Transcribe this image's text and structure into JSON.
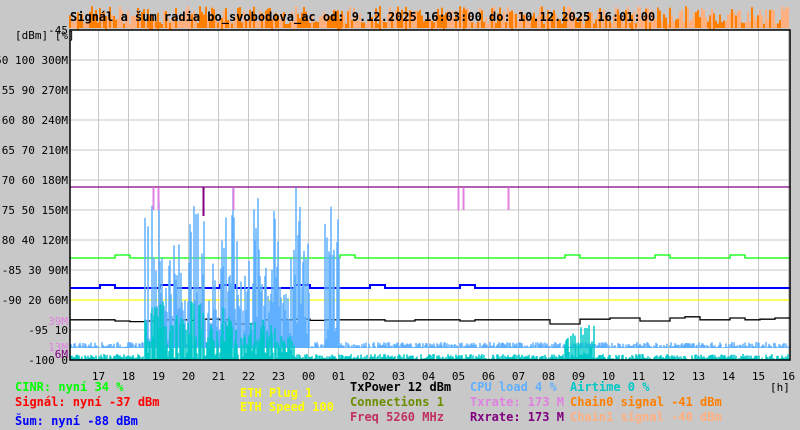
{
  "title": "Signál a šum radia bo_svobodova_ac od: 9.12.2025 16:03:00 do: 10.12.2025 16:01:00",
  "chart_data": {
    "type": "line",
    "title": "Signál a šum radia bo_svobodova_ac od: 9.12.2025 16:03:00 do: 10.12.2025 16:01:00",
    "y_unit_label": "[dBm] [%]",
    "xlabel": "[h]",
    "x_ticks": [
      "17",
      "18",
      "19",
      "20",
      "21",
      "22",
      "23",
      "00",
      "01",
      "02",
      "03",
      "04",
      "05",
      "06",
      "07",
      "08",
      "09",
      "10",
      "11",
      "12",
      "13",
      "14",
      "15",
      "16"
    ],
    "x_range": [
      "16:03",
      "16:01"
    ],
    "ylim": [
      -100,
      -45
    ],
    "y_ticks": [
      {
        "dbm": "-45",
        "pct": "",
        "rate": ""
      },
      {
        "dbm": "-50",
        "pct": "100",
        "rate": "300M"
      },
      {
        "dbm": "-55",
        "pct": "90",
        "rate": "270M"
      },
      {
        "dbm": "-60",
        "pct": "80",
        "rate": "240M"
      },
      {
        "dbm": "-65",
        "pct": "70",
        "rate": "210M"
      },
      {
        "dbm": "-70",
        "pct": "60",
        "rate": "180M"
      },
      {
        "dbm": "-75",
        "pct": "50",
        "rate": "150M"
      },
      {
        "dbm": "-80",
        "pct": "40",
        "rate": "120M"
      },
      {
        "dbm": "-85",
        "pct": "30",
        "rate": "90M"
      },
      {
        "dbm": "-90",
        "pct": "20",
        "rate": "60M"
      },
      {
        "dbm": "-95",
        "pct": "10",
        "rate": ""
      },
      {
        "dbm": "-100",
        "pct": "0",
        "rate": ""
      }
    ],
    "extra_labels": [
      {
        "text": "39M",
        "dbm": -93.5,
        "color": "#e080e0"
      },
      {
        "text": "13M",
        "dbm": -97.8,
        "color": "#e080e0"
      },
      {
        "text": "6M",
        "dbm": -99,
        "color": "#800080"
      }
    ],
    "grid": true,
    "bin_minutes": 30,
    "series": [
      {
        "name": "CINR",
        "unit": "%",
        "color": "#00ff00",
        "values": [
          34,
          34,
          34,
          35,
          34,
          34,
          34,
          34,
          34,
          34,
          34,
          34,
          34,
          34,
          34,
          34,
          34,
          34,
          35,
          34,
          34,
          34,
          34,
          34,
          34,
          34,
          34,
          34,
          34,
          34,
          34,
          34,
          34,
          35,
          34,
          34,
          34,
          34,
          34,
          35,
          34,
          34,
          34,
          34,
          35,
          34,
          34,
          34
        ]
      },
      {
        "name": "Šum",
        "unit": "dBm",
        "color": "#0000ff",
        "values": [
          -88,
          -88,
          -87.5,
          -88,
          -88,
          -88,
          -87.5,
          -88,
          -88,
          -88,
          -87.5,
          -88,
          -88,
          -88,
          -88,
          -87.5,
          -88,
          -88,
          -88,
          -88,
          -87.5,
          -88,
          -88,
          -88,
          -88,
          -88,
          -87.5,
          -88,
          -88,
          -88,
          -88,
          -88,
          -88,
          -88,
          -88,
          -88,
          -88,
          -88,
          -88,
          -88,
          -88,
          -88,
          -88,
          -88,
          -88,
          -88,
          -88,
          -88
        ]
      },
      {
        "name": "ETH",
        "unit": "dBm",
        "color": "#ffff00",
        "values": [
          -90,
          -90,
          -90,
          -90,
          -90,
          -90,
          -90,
          -90,
          -90,
          -90,
          -90,
          -90,
          -90,
          -90,
          -90,
          -90,
          -90,
          -90,
          -90,
          -90,
          -90,
          -90,
          -90,
          -90,
          -90,
          -90,
          -90,
          -90,
          -90,
          -90,
          -90,
          -90,
          -90,
          -90,
          -90,
          -90,
          -90,
          -90,
          -90,
          -90,
          -90,
          -90,
          -90,
          -90,
          -90,
          -90,
          -90,
          -90
        ]
      },
      {
        "name": "Rxrate",
        "unit": "M",
        "color": "#800080",
        "values": [
          173,
          173,
          173,
          173,
          173,
          173,
          173,
          173,
          173,
          173,
          173,
          173,
          173,
          173,
          173,
          173,
          173,
          173,
          173,
          173,
          173,
          173,
          173,
          173,
          173,
          173,
          173,
          173,
          173,
          173,
          173,
          173,
          173,
          173,
          173,
          173,
          173,
          173,
          173,
          173,
          173,
          173,
          173,
          173,
          173,
          173,
          173,
          173
        ]
      },
      {
        "name": "TxPower",
        "unit": "dBm",
        "color": "#000000",
        "values": [
          -93.3,
          -93.3,
          -93.3,
          -93.5,
          -93.6,
          -93.5,
          -93.3,
          -93.3,
          -93.4,
          -93.2,
          -93.3,
          -94,
          -94,
          -93.3,
          -93.3,
          -93.2,
          -93.4,
          -93.3,
          -93.3,
          -93.3,
          -93.3,
          -93.5,
          -93.5,
          -93.3,
          -93.3,
          -93.3,
          -93.5,
          -93.3,
          -93.3,
          -93.3,
          -93.3,
          -93.3,
          -94,
          -94,
          -93.2,
          -93.2,
          -93,
          -93,
          -93.5,
          -93.5,
          -93,
          -92.8,
          -93.3,
          -93.3,
          -93,
          -93.3,
          -93.2,
          -93
        ]
      },
      {
        "name": "CPU load",
        "unit": "%",
        "color": "#60b0ff",
        "values": [
          4,
          4,
          4,
          4,
          5,
          56,
          45,
          40,
          52,
          35,
          58,
          40,
          55,
          50,
          38,
          58,
          4,
          55,
          4,
          4,
          4,
          4,
          4,
          4,
          4,
          4,
          4,
          4,
          4,
          4,
          4,
          4,
          4,
          4,
          4,
          4,
          4,
          4,
          4,
          4,
          4,
          4,
          4,
          4,
          4,
          4,
          4,
          4
        ]
      },
      {
        "name": "Airtime",
        "unit": "%",
        "color": "#00c8c8",
        "values": [
          0,
          0,
          0,
          0,
          0,
          18,
          22,
          15,
          20,
          12,
          18,
          10,
          14,
          12,
          8,
          6,
          0,
          0,
          0,
          0,
          0,
          0,
          0,
          0,
          0,
          0,
          0,
          0,
          0,
          0,
          0,
          0,
          0,
          10,
          12,
          0,
          0,
          0,
          0,
          0,
          0,
          0,
          0,
          0,
          0,
          0,
          0,
          0
        ]
      }
    ],
    "txrate_dips": [
      "18:50",
      "19:00",
      "21:30",
      "05:00",
      "05:10",
      "06:40"
    ],
    "rxrate_dips": [
      "20:30"
    ],
    "legend": [
      {
        "text": "CINR: nyní 34 %",
        "color": "#00ff00"
      },
      {
        "text": "Signál: nyní -37 dBm",
        "color": "#ff0000"
      },
      {
        "text": "Šum: nyní -88 dBm",
        "color": "#0000ff"
      },
      {
        "text": "ETH Plug 1",
        "color": "#ffff00"
      },
      {
        "text": "ETH Speed 100",
        "color": "#ffff00"
      },
      {
        "text": "TxPower 12 dBm",
        "color": "#000000"
      },
      {
        "text": "Connections 1",
        "color": "#6b8e00"
      },
      {
        "text": "Freq 5260 MHz",
        "color": "#c03060"
      },
      {
        "text": "CPU load 4 %",
        "color": "#60b0ff"
      },
      {
        "text": "Txrate: 173 M",
        "color": "#e080e0"
      },
      {
        "text": "Rxrate: 173 M",
        "color": "#800080"
      },
      {
        "text": "Airtime 0 %",
        "color": "#00c8c8"
      },
      {
        "text": "Chain0 signal -41 dBm",
        "color": "#ff8000"
      },
      {
        "text": "Chain1 signal -40 dBm",
        "color": "#ffb080"
      }
    ]
  }
}
